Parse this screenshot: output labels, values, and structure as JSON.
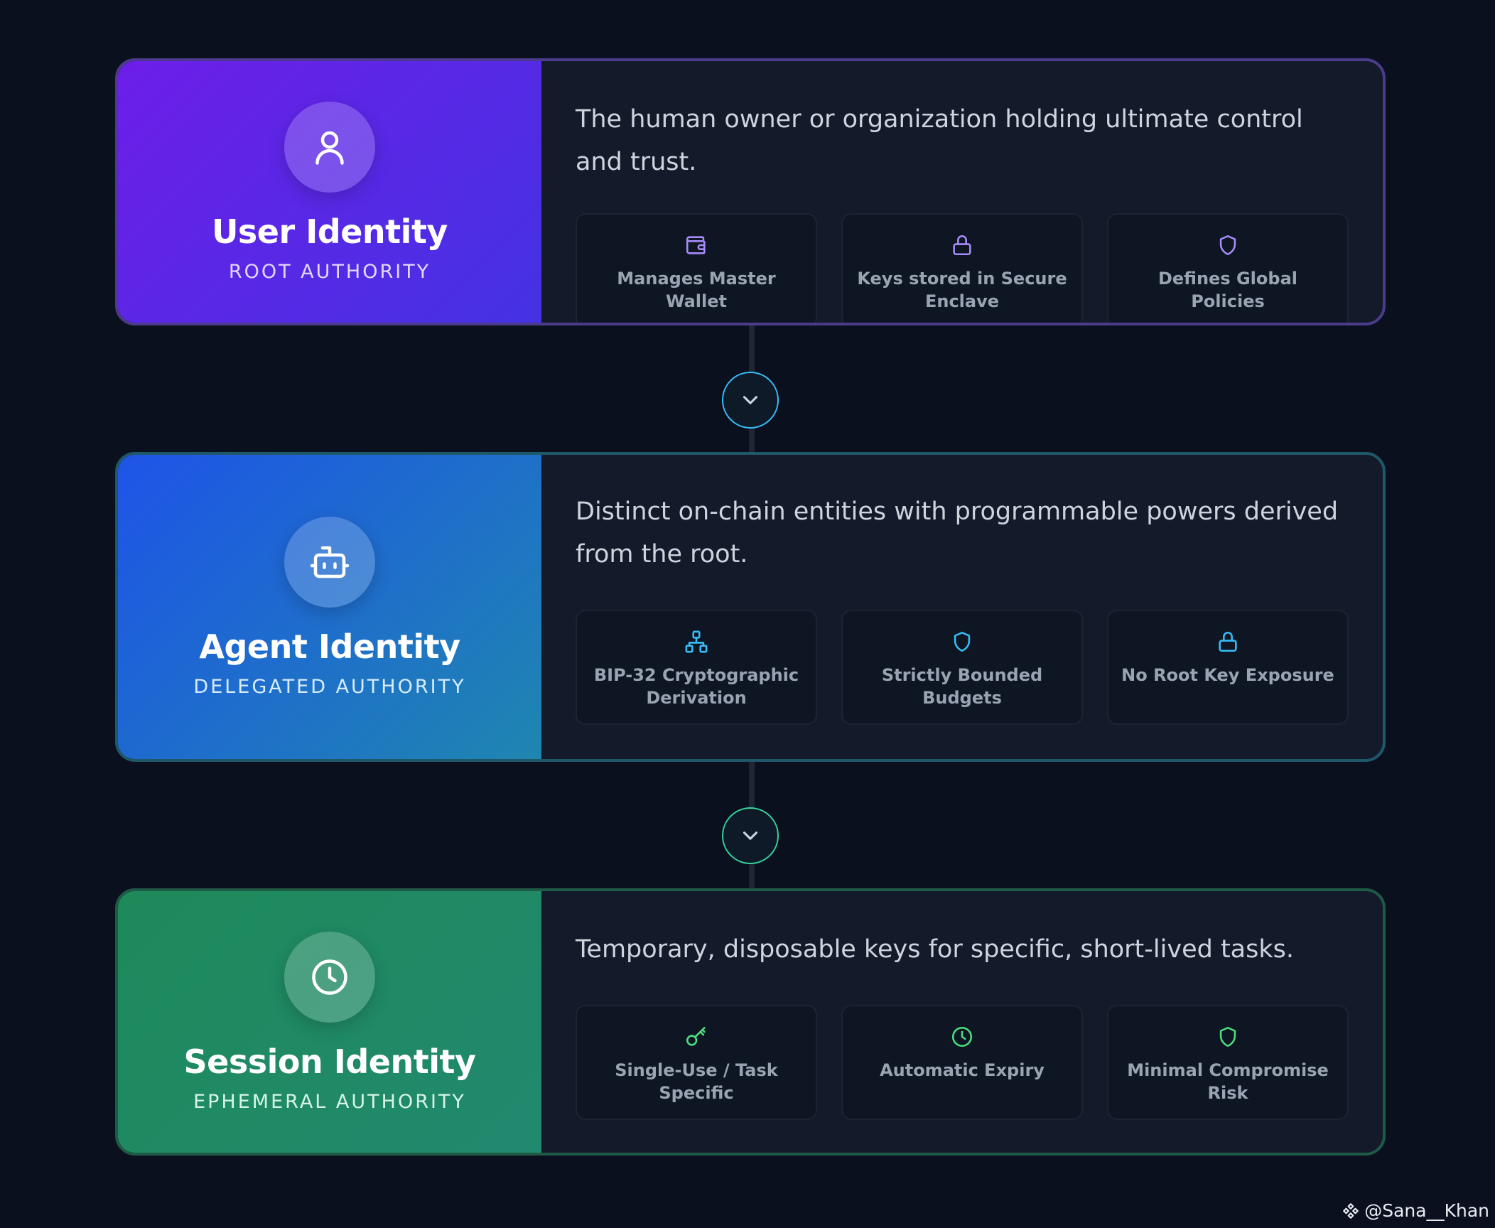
{
  "colors": {
    "background": "#0b101f",
    "user_accent": "#7c4ddb",
    "agent_accent": "#38bdf8",
    "session_accent": "#4ade80"
  },
  "cards": [
    {
      "title": "User Identity",
      "subtitle": "ROOT AUTHORITY",
      "icon": "user-icon",
      "description": "The human owner or organization holding ultimate control and trust.",
      "features": [
        {
          "label": "Manages Master Wallet",
          "icon": "wallet-icon"
        },
        {
          "label": "Keys stored in Secure Enclave",
          "icon": "lock-icon"
        },
        {
          "label": "Defines Global Policies",
          "icon": "shield-icon"
        }
      ]
    },
    {
      "title": "Agent Identity",
      "subtitle": "DELEGATED AUTHORITY",
      "icon": "robot-icon",
      "description": "Distinct on-chain entities with programmable powers derived from the root.",
      "features": [
        {
          "label": "BIP-32 Cryptographic Derivation",
          "icon": "hierarchy-icon"
        },
        {
          "label": "Strictly Bounded Budgets",
          "icon": "shield-icon"
        },
        {
          "label": "No Root Key Exposure",
          "icon": "lock-icon"
        }
      ]
    },
    {
      "title": "Session Identity",
      "subtitle": "EPHEMERAL AUTHORITY",
      "icon": "clock-icon",
      "description": "Temporary, disposable keys for specific, short-lived tasks.",
      "features": [
        {
          "label": "Single-Use / Task Specific",
          "icon": "key-icon"
        },
        {
          "label": "Automatic Expiry",
          "icon": "clock-icon"
        },
        {
          "label": "Minimal Compromise Risk",
          "icon": "shield-icon"
        }
      ]
    }
  ],
  "connectors": [
    {
      "icon": "chevron-down-icon"
    },
    {
      "icon": "chevron-down-icon"
    }
  ],
  "watermark": {
    "text": "@Sana__Khan"
  }
}
